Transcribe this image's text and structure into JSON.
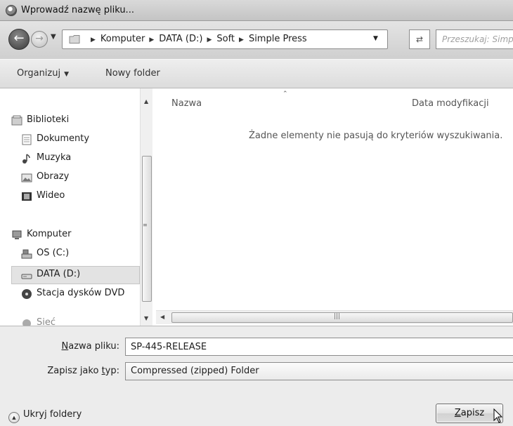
{
  "window": {
    "title": "Wprowadź nazwę pliku..."
  },
  "navigation": {
    "breadcrumb": [
      "Komputer",
      "DATA (D:)",
      "Soft",
      "Simple Press"
    ],
    "search_placeholder": "Przeszukaj: Simple Press"
  },
  "toolbar": {
    "organize_label": "Organizuj",
    "new_folder_label": "Nowy folder"
  },
  "sidebar": {
    "libraries": {
      "label": "Biblioteki",
      "items": [
        {
          "label": "Dokumenty",
          "icon": "document-icon"
        },
        {
          "label": "Muzyka",
          "icon": "music-icon"
        },
        {
          "label": "Obrazy",
          "icon": "pictures-icon"
        },
        {
          "label": "Wideo",
          "icon": "video-icon"
        }
      ]
    },
    "computer": {
      "label": "Komputer",
      "items": [
        {
          "label": "OS (C:)",
          "icon": "drive-c-icon"
        },
        {
          "label": "DATA (D:)",
          "icon": "drive-d-icon",
          "selected": true
        },
        {
          "label": "Stacja dysków DVD",
          "icon": "dvd-drive-icon"
        }
      ]
    },
    "partial_next": "Sieć"
  },
  "file_list": {
    "columns": [
      "Nazwa",
      "Data modyfikacji"
    ],
    "empty_message": "Żadne elementy nie pasują do kryteriów wyszukiwania."
  },
  "form": {
    "file_name_label_prefix": "N",
    "file_name_label_rest": "azwa pliku:",
    "file_name_value": "SP-445-RELEASE",
    "save_type_label_a": "Zapisz jako ",
    "save_type_label_u": "t",
    "save_type_label_b": "yp:",
    "save_type_value": "Compressed (zipped) Folder"
  },
  "footer": {
    "hide_folders_label": "Ukryj foldery",
    "save_button_prefix": "Z",
    "save_button_rest": "apisz"
  }
}
